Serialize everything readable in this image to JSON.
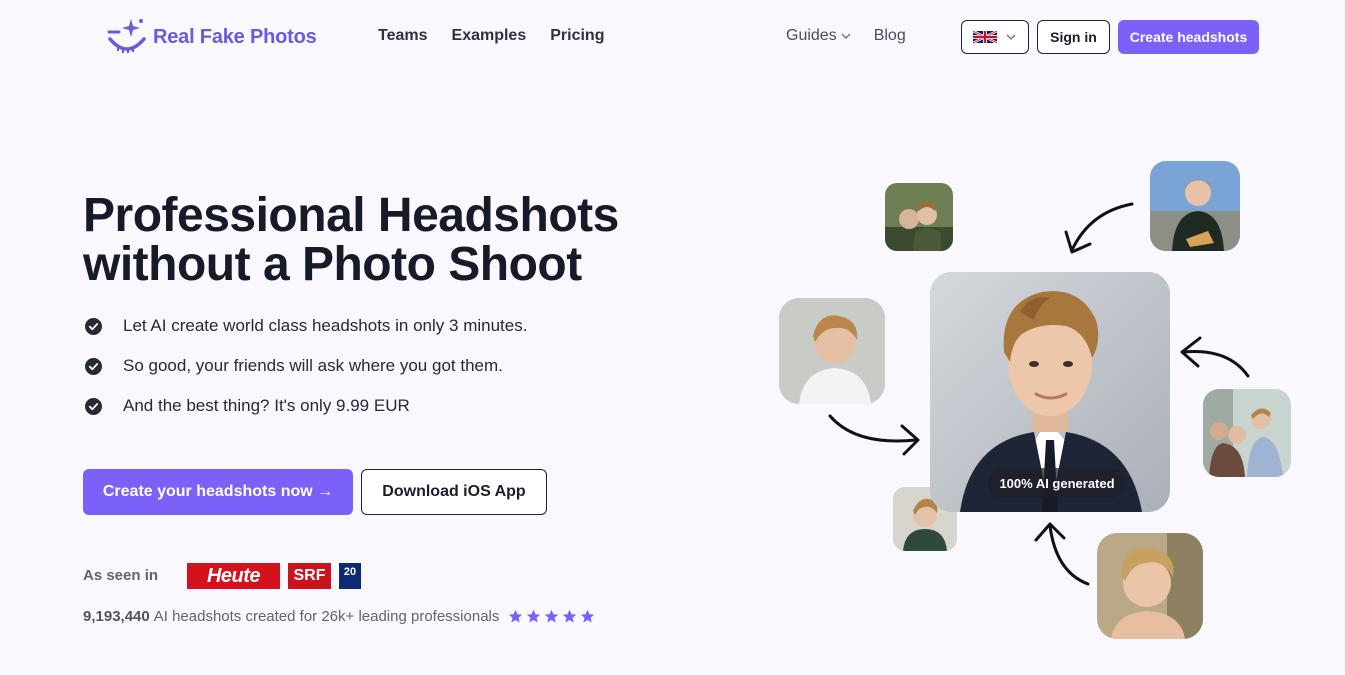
{
  "header": {
    "brand": "Real Fake Photos",
    "nav_left": [
      {
        "label": "Teams"
      },
      {
        "label": "Examples"
      },
      {
        "label": "Pricing"
      }
    ],
    "nav_right": [
      {
        "label": "Guides"
      },
      {
        "label": "Blog"
      }
    ],
    "sign_in": "Sign in",
    "cta": "Create headshots"
  },
  "hero": {
    "title": "Professional Headshots without a Photo Shoot",
    "bullets": [
      "Let AI create world class headshots in only 3 minutes.",
      "So good, your friends will ask where you got them.",
      "And the best thing? It's only 9.99 EUR"
    ],
    "primary_button": "Create your headshots now →",
    "secondary_button": "Download iOS App",
    "seen_in_label": "As seen in",
    "press_logos": {
      "heute": "Heute",
      "srf": "SRF",
      "twentymin": "20"
    },
    "stats_count": "9,193,440",
    "stats_text": "AI headshots created for 26k+ leading professionals",
    "rating_stars": 5
  },
  "collage": {
    "badge": "100% AI generated"
  },
  "colors": {
    "brand": "#7b61f8",
    "brand_text": "#6a5ae0",
    "heading": "#161a29",
    "background": "#f9f8fe"
  }
}
